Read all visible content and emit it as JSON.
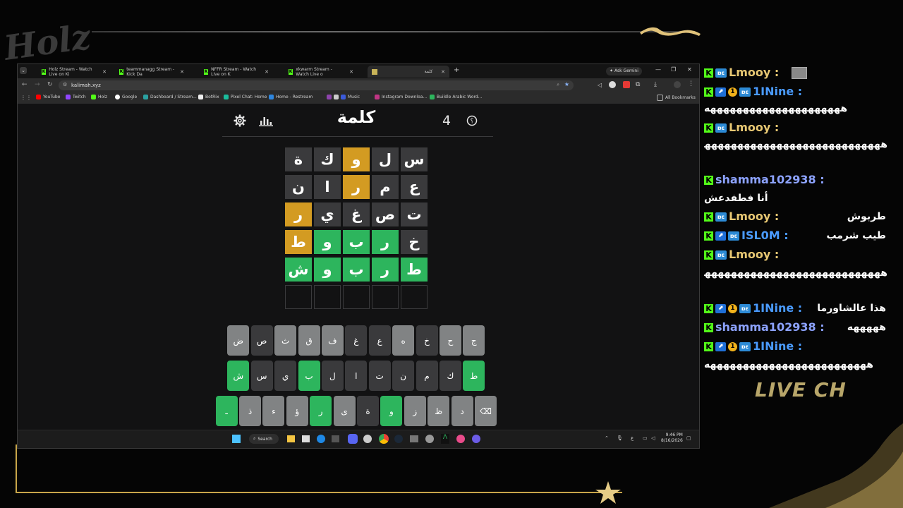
{
  "overlay": {
    "logo_text": "Holz",
    "live_chat_label": "LIVE CH"
  },
  "browser": {
    "tabs": [
      {
        "label": "Holz Stream - Watch Live on Ki",
        "icon": "kick-icon"
      },
      {
        "label": "teammanagg Stream - Kick Da",
        "icon": "kick-icon"
      },
      {
        "label": "NFFR Stream - Watch Live on K",
        "icon": "kick-icon"
      },
      {
        "label": "xkwarm Stream - Watch Live o",
        "icon": "kick-icon"
      },
      {
        "label": "كلمة",
        "icon": "kalimah-icon"
      }
    ],
    "new_tab": "+",
    "ask_gemini": "Ask Gemini",
    "url": "kalimah.xyz",
    "bookmarks": [
      "YouTube",
      "Twitch",
      "Holz",
      "Google",
      "Dashboard / Stream...",
      "BotRix",
      "Pixel Chat: Home",
      "Home - Restream",
      "Music",
      "Instagram Downloa...",
      "Buildle Arabic Word..."
    ],
    "all_bookmarks": "All Bookmarks"
  },
  "game": {
    "title": "كلمة",
    "counter": "4",
    "rows": [
      [
        {
          "l": "س",
          "s": "g"
        },
        {
          "l": "ل",
          "s": "g"
        },
        {
          "l": "و",
          "s": "y"
        },
        {
          "l": "ك",
          "s": "g"
        },
        {
          "l": "ة",
          "s": "g"
        }
      ],
      [
        {
          "l": "ع",
          "s": "g"
        },
        {
          "l": "م",
          "s": "g"
        },
        {
          "l": "ر",
          "s": "y"
        },
        {
          "l": "ا",
          "s": "g"
        },
        {
          "l": "ن",
          "s": "g"
        }
      ],
      [
        {
          "l": "ت",
          "s": "g"
        },
        {
          "l": "ص",
          "s": "g"
        },
        {
          "l": "غ",
          "s": "g"
        },
        {
          "l": "ي",
          "s": "g"
        },
        {
          "l": "ر",
          "s": "y"
        }
      ],
      [
        {
          "l": "خ",
          "s": "g"
        },
        {
          "l": "ر",
          "s": "c"
        },
        {
          "l": "ب",
          "s": "c"
        },
        {
          "l": "و",
          "s": "c"
        },
        {
          "l": "ط",
          "s": "y"
        }
      ],
      [
        {
          "l": "ط",
          "s": "c"
        },
        {
          "l": "ر",
          "s": "c"
        },
        {
          "l": "ب",
          "s": "c"
        },
        {
          "l": "و",
          "s": "c"
        },
        {
          "l": "ش",
          "s": "c"
        }
      ],
      [
        {
          "l": "",
          "s": "e"
        },
        {
          "l": "",
          "s": "e"
        },
        {
          "l": "",
          "s": "e"
        },
        {
          "l": "",
          "s": "e"
        },
        {
          "l": "",
          "s": "e"
        }
      ]
    ],
    "keyboard": [
      [
        {
          "l": "ج",
          "s": "l"
        },
        {
          "l": "ح",
          "s": "l"
        },
        {
          "l": "خ",
          "s": "d"
        },
        {
          "l": "ه",
          "s": "l"
        },
        {
          "l": "ع",
          "s": "d"
        },
        {
          "l": "غ",
          "s": "d"
        },
        {
          "l": "ف",
          "s": "l"
        },
        {
          "l": "ق",
          "s": "l"
        },
        {
          "l": "ث",
          "s": "l"
        },
        {
          "l": "ص",
          "s": "d"
        },
        {
          "l": "ض",
          "s": "l"
        }
      ],
      [
        {
          "l": "ط",
          "s": "c"
        },
        {
          "l": "ك",
          "s": "d"
        },
        {
          "l": "م",
          "s": "d"
        },
        {
          "l": "ن",
          "s": "d"
        },
        {
          "l": "ت",
          "s": "d"
        },
        {
          "l": "ا",
          "s": "d"
        },
        {
          "l": "ل",
          "s": "d"
        },
        {
          "l": "ب",
          "s": "c"
        },
        {
          "l": "ي",
          "s": "d"
        },
        {
          "l": "س",
          "s": "d"
        },
        {
          "l": "ش",
          "s": "c"
        }
      ],
      [
        {
          "l": "⌫",
          "s": "l"
        },
        {
          "l": "د",
          "s": "l"
        },
        {
          "l": "ظ",
          "s": "l"
        },
        {
          "l": "ز",
          "s": "l"
        },
        {
          "l": "و",
          "s": "c"
        },
        {
          "l": "ة",
          "s": "d"
        },
        {
          "l": "ى",
          "s": "l"
        },
        {
          "l": "ر",
          "s": "c"
        },
        {
          "l": "ؤ",
          "s": "l"
        },
        {
          "l": "ء",
          "s": "l"
        },
        {
          "l": "ذ",
          "s": "l"
        },
        {
          "l": "ـ",
          "s": "c"
        }
      ]
    ]
  },
  "taskbar": {
    "search": "Search",
    "time": "9:46 PM",
    "date": "8/16/2026"
  },
  "chat": {
    "messages": [
      {
        "user": "Lmooy",
        "color": "#e8c873",
        "text": "",
        "badges": [
          "k",
          "b3"
        ]
      },
      {
        "user": "1INine",
        "color": "#4a9bff",
        "text": "هههههههههههههههههههههه",
        "badges": [
          "k",
          "b1",
          "b2",
          "b3"
        ]
      },
      {
        "user": "Lmooy",
        "color": "#e8c873",
        "text": "ههههههههههههههههههههههههههههههههههه",
        "badges": [
          "k",
          "b3"
        ]
      },
      {
        "user": "shamma102938",
        "color": "#8da3ff",
        "text": "أنا فطفدعش",
        "badges": [
          "k"
        ]
      },
      {
        "user": "Lmooy",
        "color": "#e8c873",
        "text": "طربوش",
        "badges": [
          "k",
          "b3"
        ]
      },
      {
        "user": "ISL0M",
        "color": "#4a9bff",
        "text": "طيب شرمب",
        "badges": [
          "k",
          "b1",
          "b3"
        ]
      },
      {
        "user": "Lmooy",
        "color": "#e8c873",
        "text": "هههههههههههههههههههههههههههههههه",
        "badges": [
          "k",
          "b3"
        ]
      },
      {
        "user": "1INine",
        "color": "#4a9bff",
        "text": "هذا عالشاورما",
        "badges": [
          "k",
          "b1",
          "b2",
          "b3"
        ]
      },
      {
        "user": "shamma102938",
        "color": "#8da3ff",
        "text": "هههههه",
        "badges": [
          "k"
        ]
      },
      {
        "user": "1INine",
        "color": "#4a9bff",
        "text": "هههههههههههههههههههههههههه",
        "badges": [
          "k",
          "b1",
          "b2",
          "b3"
        ]
      }
    ]
  }
}
